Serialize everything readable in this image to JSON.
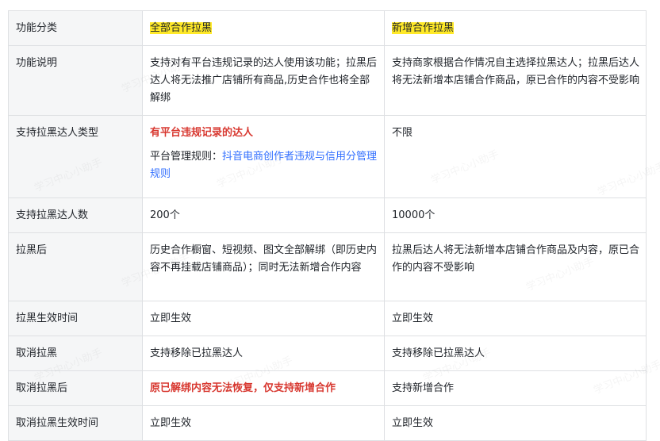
{
  "table": {
    "header": [
      "功能分类",
      "全部合作拉黑",
      "新增合作拉黑"
    ],
    "rows": [
      {
        "label": "功能说明",
        "all": "支持对有平台违规记录的达人使用该功能；拉黑后达人将无法推广店铺所有商品,历史合作也将全部解绑",
        "new": "支持商家根据合作情况自主选择拉黑达人；拉黑后达人将无法新增本店铺合作商品，原已合作的内容不受影响"
      },
      {
        "label": "支持拉黑达人类型",
        "all_emph": "有平台违规记录的达人",
        "all_rule_prefix": "平台管理规则：",
        "all_rule_link": "抖音电商创作者违规与信用分管理规则",
        "new": "不限"
      },
      {
        "label": "支持拉黑达人数",
        "all": "200个",
        "new": "10000个"
      },
      {
        "label": "拉黑后",
        "all": "历史合作橱窗、短视频、图文全部解绑（即历史内容不再挂载店铺商品）；同时无法新增合作内容",
        "new": "拉黑后达人将无法新增本店铺合作商品及内容，原已合作的内容不受影响"
      },
      {
        "label": "拉黑生效时间",
        "all": "立即生效",
        "new": "立即生效"
      },
      {
        "label": "取消拉黑",
        "all": "支持移除已拉黑达人",
        "new": "支持移除已拉黑达人"
      },
      {
        "label": "取消拉黑后",
        "all_emph": "原已解绑内容无法恢复，仅支持新增合作",
        "new": "支持新增合作"
      },
      {
        "label": "取消拉黑生效时间",
        "all": "立即生效",
        "new": "立即生效"
      }
    ]
  },
  "watermark": "学习中心小助手"
}
